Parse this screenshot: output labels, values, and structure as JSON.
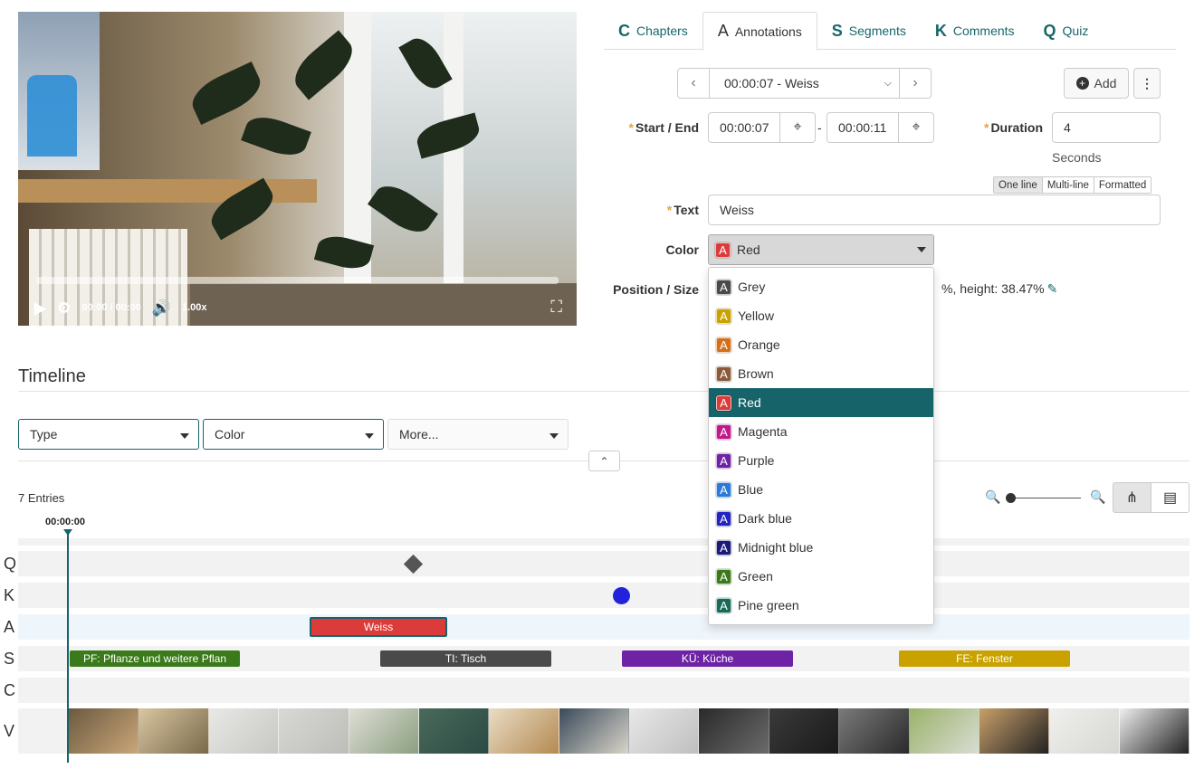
{
  "video": {
    "time": "00:00 / 00:00",
    "speed": "1.00x"
  },
  "tabs": [
    {
      "icon": "C",
      "label": "Chapters"
    },
    {
      "icon": "A",
      "label": "Annotations"
    },
    {
      "icon": "S",
      "label": "Segments"
    },
    {
      "icon": "K",
      "label": "Comments"
    },
    {
      "icon": "Q",
      "label": "Quiz"
    }
  ],
  "annotation": {
    "selected": "00:00:07 - Weiss",
    "add_label": "Add",
    "start_end_label": "Start / End",
    "start": "00:00:07",
    "end": "00:00:11",
    "range_separator": "-",
    "duration_label": "Duration",
    "duration": "4",
    "duration_unit": "Seconds",
    "text_modes": [
      "One line",
      "Multi-line",
      "Formatted"
    ],
    "text_label": "Text",
    "text": "Weiss",
    "color_label": "Color",
    "color_value": "Red",
    "color_value_hex": "#dc3b3b",
    "position_label": "Position / Size",
    "position_value_partial": "%, height: 38.47%",
    "badge_letter": "A"
  },
  "color_options": [
    {
      "label": "Grey",
      "hex": "#4a4a4a"
    },
    {
      "label": "Yellow",
      "hex": "#c9a200"
    },
    {
      "label": "Orange",
      "hex": "#d3701a"
    },
    {
      "label": "Brown",
      "hex": "#8a5a3a"
    },
    {
      "label": "Red",
      "hex": "#dc3b3b"
    },
    {
      "label": "Magenta",
      "hex": "#c21a8a"
    },
    {
      "label": "Purple",
      "hex": "#6e23a6"
    },
    {
      "label": "Blue",
      "hex": "#2a7ad6"
    },
    {
      "label": "Dark blue",
      "hex": "#2424c2"
    },
    {
      "label": "Midnight blue",
      "hex": "#1a1a7a"
    },
    {
      "label": "Green",
      "hex": "#3a7a1a"
    },
    {
      "label": "Pine green",
      "hex": "#1a6a5a"
    }
  ],
  "timeline": {
    "title": "Timeline",
    "filters": [
      "Type",
      "Color",
      "More..."
    ],
    "entries": "7 Entries",
    "timestamp": "00:00:00",
    "tracks": [
      "Q",
      "K",
      "A",
      "S",
      "C",
      "V"
    ],
    "annotation_segment": "Weiss",
    "segments": [
      {
        "label": "PF: Pflanze und weitere Pflan",
        "hex": "#3a7a1a"
      },
      {
        "label": "TI: Tisch",
        "hex": "#4a4a4a"
      },
      {
        "label": "KÜ: Küche",
        "hex": "#6e23a6"
      },
      {
        "label": "FE: Fenster",
        "hex": "#c9a200"
      }
    ]
  },
  "icons": {
    "play": "play-icon",
    "settings": "gear-icon",
    "volume": "volume-icon",
    "fullscreen": "fullscreen-icon",
    "prev": "chevron-left-icon",
    "next": "chevron-right-icon",
    "add": "plus-circle-icon",
    "more": "more-vertical-icon",
    "target": "crosshair-icon",
    "edit": "edit-icon",
    "collapse": "chevron-up-icon",
    "zoom_out": "zoom-out-icon",
    "zoom_in": "zoom-in-icon",
    "tree_view": "tree-view-icon",
    "list_view": "list-view-icon"
  },
  "accent": "#17636a"
}
